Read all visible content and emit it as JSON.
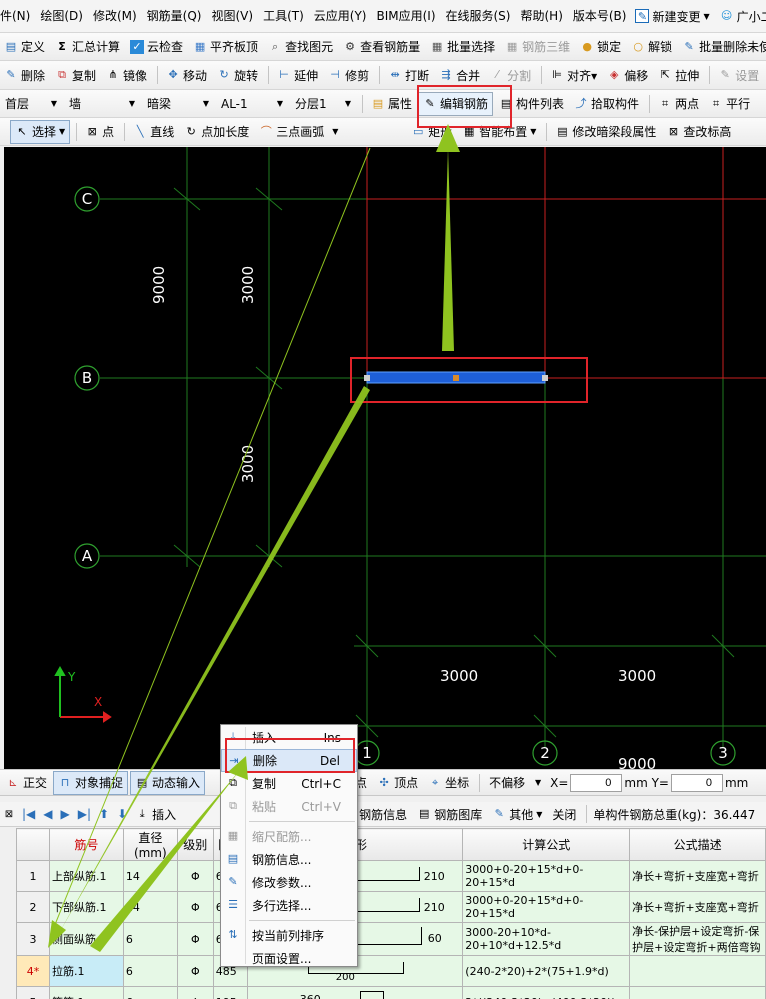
{
  "menu": [
    "件(N)",
    "绘图(D)",
    "修改(M)",
    "钢筋量(Q)",
    "视图(V)",
    "工具(T)",
    "云应用(Y)",
    "BIM应用(I)",
    "在线服务(S)",
    "帮助(H)",
    "版本号(B)",
    "新建变更",
    "广小二"
  ],
  "toolbar1": [
    {
      "label": "定义",
      "icon": "▤",
      "enabled": true
    },
    {
      "label": "汇总计算",
      "icon": "Σ",
      "enabled": true
    },
    {
      "label": "云检查",
      "icon": "☑",
      "enabled": true
    },
    {
      "label": "平齐板顶",
      "icon": "▦",
      "enabled": true
    },
    {
      "label": "查找图元",
      "icon": "⌕",
      "enabled": true
    },
    {
      "label": "查看钢筋量",
      "icon": "⚙",
      "enabled": true
    },
    {
      "label": "批量选择",
      "icon": "▦",
      "enabled": true
    },
    {
      "label": "钢筋三维",
      "icon": "▦",
      "enabled": false
    },
    {
      "label": "锁定",
      "icon": "🔒",
      "enabled": true
    },
    {
      "label": "解锁",
      "icon": "🔓",
      "enabled": true
    },
    {
      "label": "批量删除未使",
      "icon": "✎",
      "enabled": true
    }
  ],
  "toolbar2": [
    {
      "label": "删除",
      "icon": "✎",
      "enabled": true
    },
    {
      "label": "复制",
      "icon": "⧉",
      "enabled": true
    },
    {
      "label": "镜像",
      "icon": "⋔",
      "enabled": true
    },
    {
      "label": "移动",
      "icon": "✥",
      "enabled": true
    },
    {
      "label": "旋转",
      "icon": "↻",
      "enabled": true
    },
    {
      "label": "延伸",
      "icon": "⊢",
      "enabled": true
    },
    {
      "label": "修剪",
      "icon": "⊣",
      "enabled": true
    },
    {
      "label": "打断",
      "icon": "⇹",
      "enabled": true
    },
    {
      "label": "合并",
      "icon": "⇶",
      "enabled": true
    },
    {
      "label": "分割",
      "icon": "⁄",
      "enabled": false
    },
    {
      "label": "对齐▾",
      "icon": "⊫",
      "enabled": true
    },
    {
      "label": "偏移",
      "icon": "◈",
      "enabled": true
    },
    {
      "label": "拉伸",
      "icon": "⇱",
      "enabled": true
    },
    {
      "label": "设置",
      "icon": "✎",
      "enabled": false
    }
  ],
  "toolbar3": {
    "floor": "首层",
    "type": "墙",
    "sub": "暗梁",
    "element": "AL-1",
    "layer": "分层1",
    "buttons": [
      {
        "label": "属性",
        "icon": "▤"
      },
      {
        "label": "编辑钢筋",
        "icon": "✎"
      },
      {
        "label": "构件列表",
        "icon": "▤"
      },
      {
        "label": "拾取构件",
        "icon": "⤴"
      },
      {
        "label": "两点",
        "icon": "⌗"
      },
      {
        "label": "平行",
        "icon": "⌗"
      }
    ]
  },
  "toolbar4": [
    {
      "label": "选择",
      "icon": "↖"
    },
    {
      "label": "点",
      "icon": "⊠"
    },
    {
      "label": "直线",
      "icon": "╲"
    },
    {
      "label": "点加长度",
      "icon": "↻"
    },
    {
      "label": "三点画弧",
      "icon": "⌒"
    },
    {
      "label": "矩形",
      "icon": "▭"
    },
    {
      "label": "智能布置",
      "icon": "▦"
    },
    {
      "label": "修改暗梁段属性",
      "icon": "▤"
    },
    {
      "label": "查改标高",
      "icon": "⊠"
    }
  ],
  "canvas": {
    "axis_rows": [
      "C",
      "B",
      "A"
    ],
    "axis_cols": [
      "1",
      "2",
      "3"
    ],
    "dims": [
      "9000",
      "3000",
      "3000",
      "3000",
      "3000",
      "9000"
    ],
    "ucs_x": "X",
    "ucs_y": "Y"
  },
  "status": {
    "buttons": [
      "正交",
      "对象捕捉",
      "动态输入",
      "点",
      "顶点",
      "坐标"
    ],
    "offset": "不偏移",
    "x_label": "X=",
    "x_value": "0",
    "y_label": "mm Y=",
    "y_value": "0",
    "unit": "mm"
  },
  "panel": {
    "insert": "插入",
    "info": "钢筋信息",
    "library": "钢筋图库",
    "other": "其他",
    "close": "关闭",
    "total": "单构件钢筋总重(kg)：36.447"
  },
  "table": {
    "headers": [
      "",
      "筋号",
      "直径(mm)",
      "级别",
      "图号",
      "图形",
      "计算公式",
      "公式描述"
    ],
    "rows": [
      {
        "num": "1",
        "name": "上部纵筋.1",
        "dia": "14",
        "grade": "Φ",
        "fig": "64",
        "shape_val": "210",
        "formula": "3000+0-20+15*d+0-20+15*d",
        "desc": "净长+弯折+支座宽+弯折"
      },
      {
        "num": "2",
        "name": "下部纵筋.1",
        "dia": "14",
        "grade": "Φ",
        "fig": "64",
        "shape_val": "210",
        "formula": "3000+0-20+15*d+0-20+15*d",
        "desc": "净长+弯折+支座宽+弯折"
      },
      {
        "num": "3",
        "name": "侧面纵筋.1",
        "dia": "6",
        "grade": "Φ",
        "fig": "63",
        "shape_val": "60",
        "formula": "3000-20+10*d-20+10*d+12.5*d",
        "desc": "净长-保护层+设定弯折-保护层+设定弯折+两倍弯钩"
      },
      {
        "num": "4*",
        "name": "拉筋.1",
        "dia": "6",
        "grade": "Φ",
        "fig": "485",
        "shape_val": "200",
        "formula": "(240-2*20)+2*(75+1.9*d)",
        "desc": ""
      },
      {
        "num": "5",
        "name": "箍筋.1",
        "dia": "6",
        "grade": "Φ",
        "fig": "195",
        "shape_val": "360",
        "formula": "2*((240-2*20)+(400-2*20))+",
        "desc": ""
      }
    ]
  },
  "context_menu": [
    {
      "label": "插入",
      "shortcut": "Ins",
      "enabled": true,
      "icon": "⤓"
    },
    {
      "label": "删除",
      "shortcut": "Del",
      "enabled": true,
      "icon": "⇥"
    },
    {
      "label": "复制",
      "shortcut": "Ctrl+C",
      "enabled": true,
      "icon": "⧉"
    },
    {
      "label": "粘贴",
      "shortcut": "Ctrl+V",
      "enabled": false,
      "icon": "⧉"
    },
    {
      "label": "缩尺配筋...",
      "shortcut": "",
      "enabled": false,
      "icon": "▦"
    },
    {
      "label": "钢筋信息...",
      "shortcut": "",
      "enabled": true,
      "icon": "▤"
    },
    {
      "label": "修改参数...",
      "shortcut": "",
      "enabled": true,
      "icon": "✎"
    },
    {
      "label": "多行选择...",
      "shortcut": "",
      "enabled": true,
      "icon": "☰"
    },
    {
      "label": "按当前列排序",
      "shortcut": "",
      "enabled": true,
      "icon": "⇅"
    },
    {
      "label": "页面设置...",
      "shortcut": "",
      "enabled": true,
      "icon": ""
    }
  ]
}
